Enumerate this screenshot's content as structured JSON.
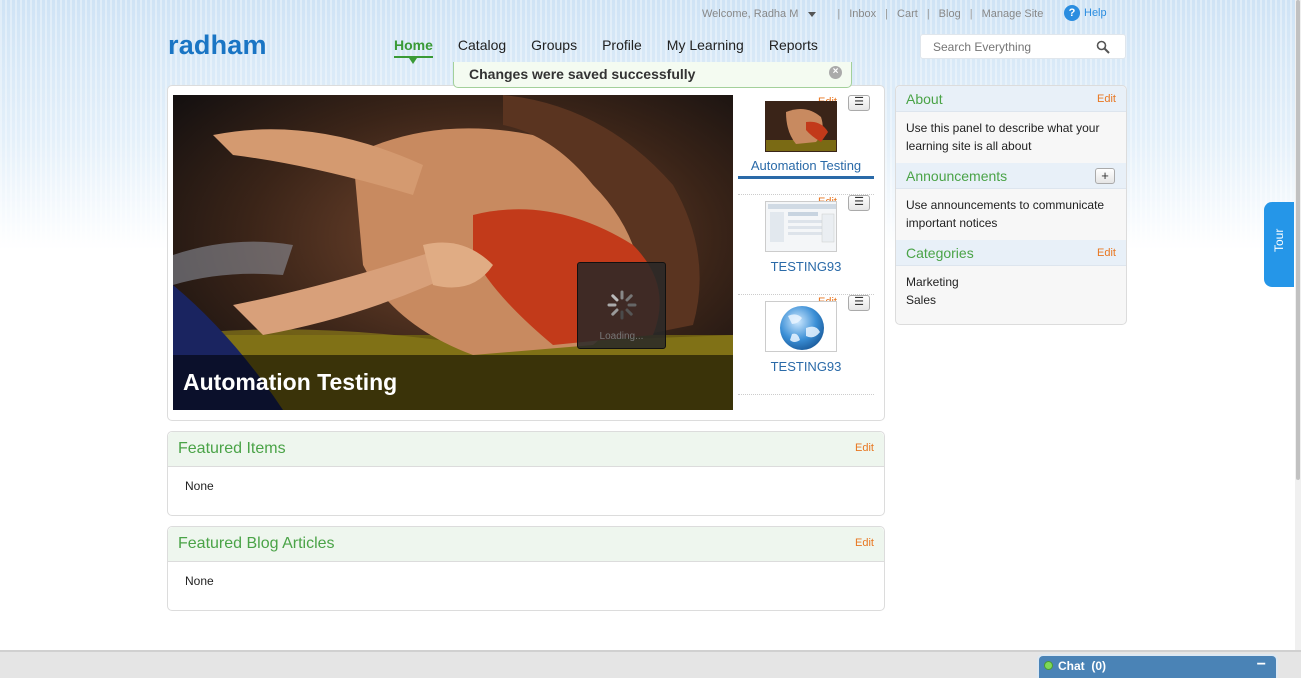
{
  "header": {
    "welcome": "Welcome, Radha M",
    "util_links": [
      "Inbox",
      "Cart",
      "Blog",
      "Manage Site"
    ],
    "help": "Help",
    "logo": "radham",
    "nav": [
      "Home",
      "Catalog",
      "Groups",
      "Profile",
      "My Learning",
      "Reports"
    ],
    "active_nav": "Home",
    "search_placeholder": "Search Everything"
  },
  "notice": {
    "text": "Changes were saved successfully"
  },
  "carousel": {
    "hero_caption": "Automation Testing",
    "loading": "Loading...",
    "thumbs": [
      {
        "name": "Automation Testing",
        "edit": "Edit",
        "thumb_icon": "wrestling-photo"
      },
      {
        "name": "TESTING93",
        "edit": "Edit",
        "thumb_icon": "screenshot-thumb"
      },
      {
        "name": "TESTING93",
        "edit": "Edit",
        "thumb_icon": "globe-icon"
      }
    ]
  },
  "featured_items": {
    "title": "Featured Items",
    "edit": "Edit",
    "body": "None"
  },
  "featured_blog": {
    "title": "Featured Blog Articles",
    "edit": "Edit",
    "body": "None"
  },
  "sidebar": {
    "about": {
      "title": "About",
      "edit": "Edit",
      "body": "Use this panel to describe what your learning site is all about"
    },
    "announcements": {
      "title": "Announcements",
      "add": "+",
      "body": "Use announcements to communicate important notices"
    },
    "categories": {
      "title": "Categories",
      "edit": "Edit",
      "items": [
        "Marketing",
        "Sales"
      ]
    }
  },
  "tour": "Tour",
  "chat": {
    "label": "Chat",
    "count": "(0)"
  },
  "colors": {
    "brand_blue": "#1a75c4",
    "nav_active_green": "#3a9a36",
    "edit_orange": "#e87722",
    "link_blue": "#2a6aa8",
    "tour_blue": "#2596e8"
  }
}
